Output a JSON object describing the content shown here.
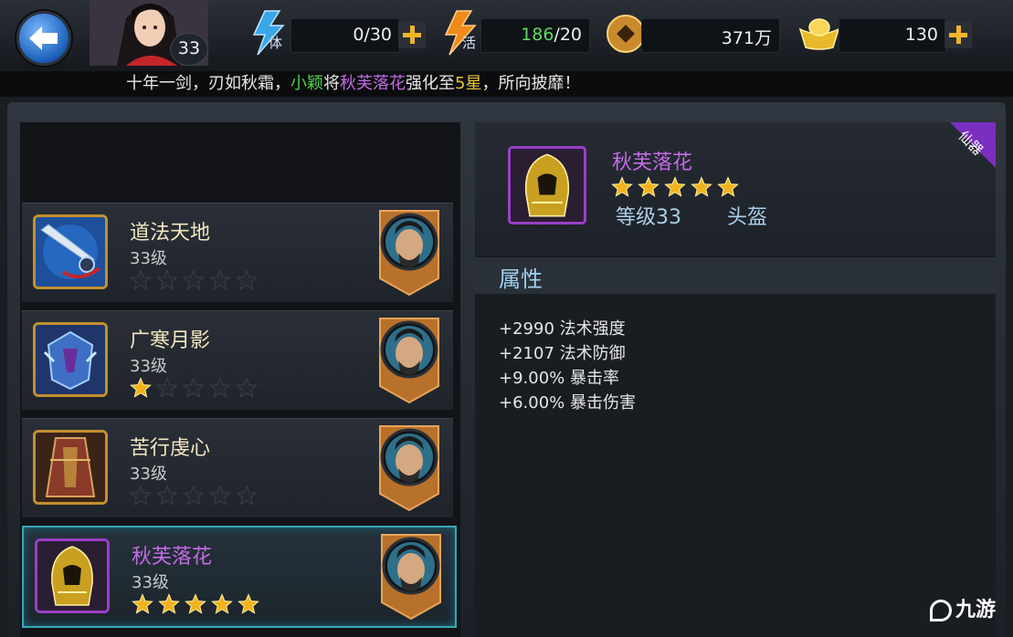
{
  "player": {
    "level": "33"
  },
  "resources": {
    "stamina": {
      "icon_label": "体",
      "value": "0/30"
    },
    "vitality": {
      "icon_label": "活",
      "value_current": "186",
      "value_max": "/20"
    },
    "coins": {
      "value": "371万"
    },
    "ingots": {
      "value": "130"
    }
  },
  "ticker": {
    "part1": "十年一剑，刃如秋霜，",
    "player_name": "小颖",
    "part2": "将",
    "item_name": "秋芙落花",
    "part3": "强化至",
    "stars_text": "5星",
    "part4": "，所向披靡！"
  },
  "list": [
    {
      "name": "道法天地",
      "level": "33级",
      "stars": 0,
      "max_stars": 5
    },
    {
      "name": "广寒月影",
      "level": "33级",
      "stars": 1,
      "max_stars": 5
    },
    {
      "name": "苦行虔心",
      "level": "33级",
      "stars": 0,
      "max_stars": 5
    },
    {
      "name": "秋芙落花",
      "level": "33级",
      "stars": 5,
      "max_stars": 5
    }
  ],
  "detail": {
    "ribbon": "仙器",
    "name": "秋芙落花",
    "stars": 5,
    "level": "等级33",
    "slot": "头盔",
    "section_title": "属性",
    "attributes": [
      "+2990 法术强度",
      "+2107 法术防御",
      "+9.00% 暴击率",
      "+6.00% 暴击伤害"
    ]
  },
  "watermark": "九游",
  "colors": {
    "accent_gold": "#f0b52a",
    "epic_purple": "#c46be6",
    "ticker_green": "#4cd24c",
    "ticker_yellow": "#e8c63a",
    "selected_border": "#3aa5b8"
  }
}
